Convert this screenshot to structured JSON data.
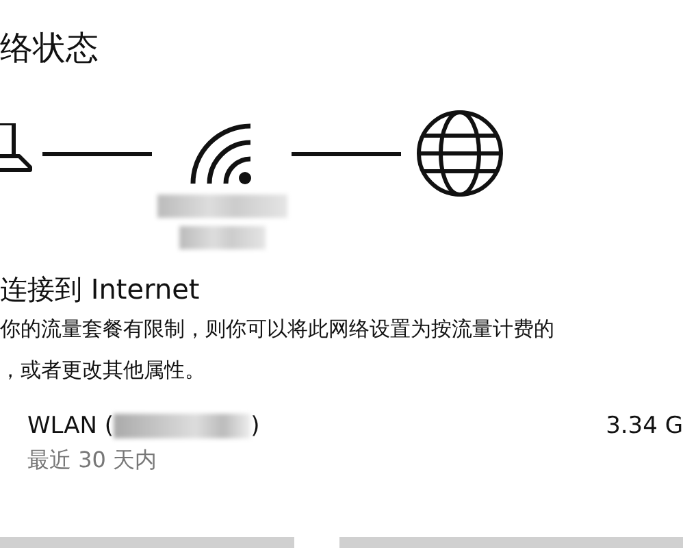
{
  "title": "络状态",
  "status": {
    "heading": "连接到 Internet",
    "description": [
      "你的流量套餐有限制，则你可以将此网络设置为按流量计费的",
      "，或者更改其他属性。"
    ]
  },
  "usage": {
    "name_start": "WLAN (",
    "name_end": ")",
    "period": "最近 30 天内",
    "amount": "3.34 G"
  }
}
